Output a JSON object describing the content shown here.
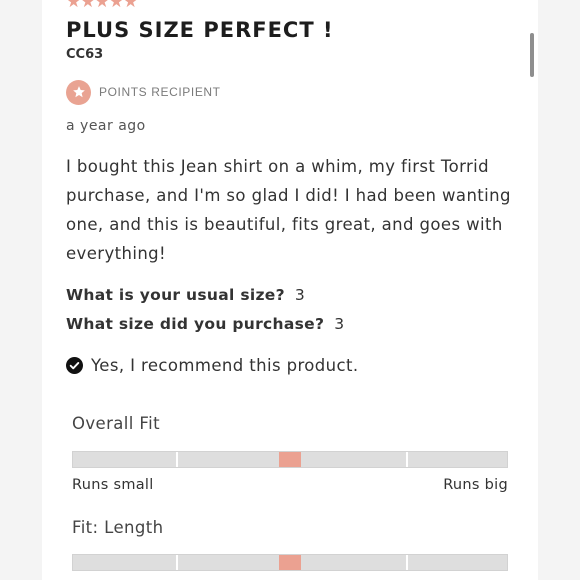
{
  "review": {
    "rating_stars": "★★★★★",
    "rating": 5,
    "title": "PLUS SIZE PERFECT !",
    "author": "CC63",
    "badge_label": "POINTS RECIPIENT",
    "date": "a year ago",
    "text": "I bought this Jean shirt on a whim, my first Torrid purchase, and I'm so glad I did! I had been wanting one, and this is beautiful, fits great, and goes with everything!",
    "questions": [
      {
        "question": "What is your usual size?",
        "answer": "3"
      },
      {
        "question": "What size did you purchase?",
        "answer": "3"
      }
    ],
    "recommend_text": "Yes, I recommend this product."
  },
  "fit": {
    "scale_low": "Runs small",
    "scale_high": "Runs big",
    "sliders": [
      {
        "label": "Overall Fit",
        "value": 0.5
      },
      {
        "label": "Fit: Length",
        "value": 0.5
      }
    ]
  },
  "colors": {
    "accent": "#eba191",
    "bar": "#dedede",
    "text": "#333333"
  }
}
